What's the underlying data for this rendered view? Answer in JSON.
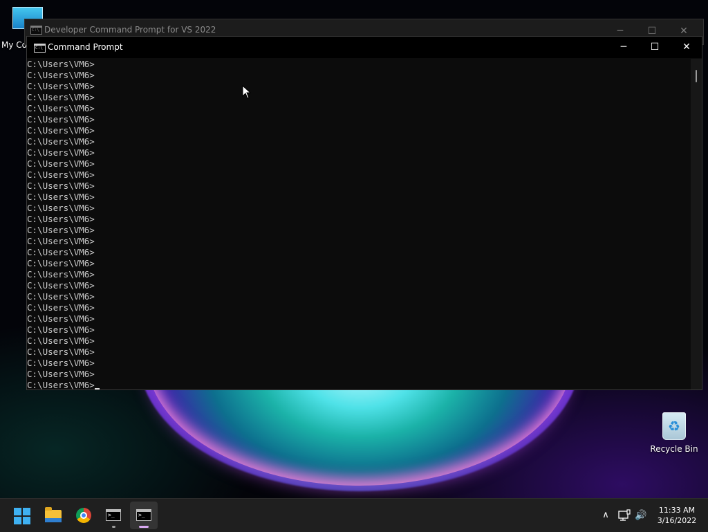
{
  "desktop": {
    "icons": [
      {
        "label": "My Co"
      },
      {
        "label": "Recycle Bin"
      }
    ]
  },
  "back_window": {
    "title": "Developer Command Prompt for VS 2022"
  },
  "main_window": {
    "title": "Command Prompt",
    "controls": {
      "minimize": "─",
      "maximize": "☐",
      "close": "✕"
    },
    "console_lines": [
      "C:\\Users\\VM6>",
      "C:\\Users\\VM6>",
      "C:\\Users\\VM6>",
      "C:\\Users\\VM6>",
      "C:\\Users\\VM6>",
      "C:\\Users\\VM6>",
      "C:\\Users\\VM6>",
      "C:\\Users\\VM6>",
      "C:\\Users\\VM6>",
      "C:\\Users\\VM6>",
      "C:\\Users\\VM6>",
      "C:\\Users\\VM6>",
      "C:\\Users\\VM6>",
      "C:\\Users\\VM6>",
      "C:\\Users\\VM6>",
      "C:\\Users\\VM6>",
      "C:\\Users\\VM6>",
      "C:\\Users\\VM6>",
      "C:\\Users\\VM6>",
      "C:\\Users\\VM6>",
      "C:\\Users\\VM6>",
      "C:\\Users\\VM6>",
      "C:\\Users\\VM6>",
      "C:\\Users\\VM6>",
      "C:\\Users\\VM6>",
      "C:\\Users\\VM6>",
      "C:\\Users\\VM6>",
      "C:\\Users\\VM6>",
      "C:\\Users\\VM6>"
    ],
    "prompt": "C:\\Users\\VM6>"
  },
  "taskbar": {
    "apps": [
      {
        "name": "start-icon"
      },
      {
        "name": "file-explorer-icon"
      },
      {
        "name": "chrome-icon"
      },
      {
        "name": "developer-command-prompt-icon"
      },
      {
        "name": "command-prompt-icon"
      }
    ],
    "tray": {
      "chevron": "∧",
      "volume": "🔊"
    },
    "clock": {
      "time": "11:33 AM",
      "date": "3/16/2022"
    }
  }
}
